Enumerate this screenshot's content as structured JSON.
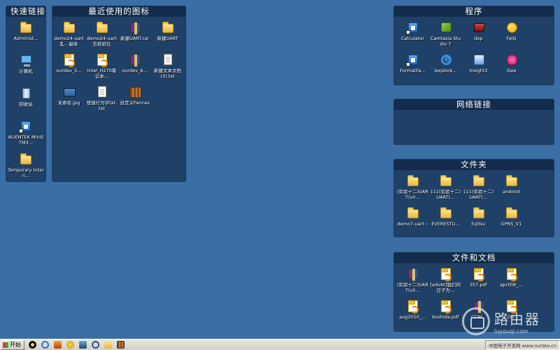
{
  "quick_links": {
    "title": "快速链接",
    "items": [
      {
        "label": "Administ...",
        "icon": "user-folder-icon"
      },
      {
        "label": "计算机",
        "icon": "computer-icon"
      },
      {
        "label": "回收站",
        "icon": "recycle-bin-icon"
      },
      {
        "label": "ALIENTEK MiniSTM3...",
        "icon": "app-shortcut-icon"
      },
      {
        "label": "Temporary Intern...",
        "icon": "folder-icon"
      }
    ]
  },
  "recent": {
    "title": "最近使用的图标",
    "items": [
      {
        "label": "demo24-uart乱 - 副本",
        "icon": "folder-icon"
      },
      {
        "label": "demo24-uart去校验位",
        "icon": "folder-icon"
      },
      {
        "label": "新建UART.rar",
        "icon": "rar-archive-icon"
      },
      {
        "label": "新建UART",
        "icon": "folder-icon"
      },
      {
        "label": "ourdev_5...",
        "icon": "pdf-icon"
      },
      {
        "label": "Intel_H270笔记本...",
        "icon": "pdf-icon"
      },
      {
        "label": "ourdev_6...",
        "icon": "rar-archive-icon"
      },
      {
        "label": "新建文本文档 (3).txt",
        "icon": "text-file-icon"
      },
      {
        "label": "未命名.jpg",
        "icon": "image-file-icon"
      },
      {
        "label": "怪诞行为学txt.txt",
        "icon": "text-file-icon"
      },
      {
        "label": "自定义Fences",
        "icon": "fences-icon"
      }
    ]
  },
  "programs": {
    "title": "程序",
    "items": [
      {
        "label": "Calculator",
        "icon": "calculator-icon"
      },
      {
        "label": "Camtasia Studio 7",
        "icon": "camtasia-icon"
      },
      {
        "label": "dxp",
        "icon": "dxp-icon"
      },
      {
        "label": "FeiQ",
        "icon": "feiq-icon"
      },
      {
        "label": "FormatFa...",
        "icon": "format-app-icon"
      },
      {
        "label": "iexplore...",
        "icon": "internet-explorer-icon"
      },
      {
        "label": "Insight3",
        "icon": "insight-icon"
      },
      {
        "label": "iSee",
        "icon": "isee-icon"
      }
    ]
  },
  "network": {
    "title": "网络链接",
    "items": []
  },
  "folders": {
    "title": "文件夹",
    "items": [
      {
        "label": "(实验十二)UART(v0...",
        "icon": "folder-icon"
      },
      {
        "label": "111(实验十二)UART(...",
        "icon": "folder-icon"
      },
      {
        "label": "111(实验十二)UART(...",
        "icon": "folder-icon"
      },
      {
        "label": "android",
        "icon": "folder-icon"
      },
      {
        "label": "demo7-uart~",
        "icon": "folder-icon"
      },
      {
        "label": "EVERESTU...",
        "icon": "folder-icon"
      },
      {
        "label": "fujitsu",
        "icon": "folder-icon"
      },
      {
        "label": "GPRS_V1",
        "icon": "folder-icon"
      }
    ]
  },
  "docs": {
    "title": "文件和文档",
    "items": [
      {
        "label": "(实验十二)UART(v0...",
        "icon": "rar-archive-icon"
      },
      {
        "label": "[edubt]我们的日子为...",
        "icon": "pdf-icon"
      },
      {
        "label": "357.pdf",
        "icon": "pdf-icon"
      },
      {
        "label": "april08_...",
        "icon": "pdf-icon"
      },
      {
        "label": "aug2010_...",
        "icon": "pdf-icon"
      },
      {
        "label": "boshida.pdf",
        "icon": "pdf-icon"
      },
      {
        "label": "CCW...",
        "icon": "rar-archive-icon"
      },
      {
        "label": "COB...",
        "icon": "pdf-icon"
      }
    ]
  },
  "taskbar": {
    "start_label": "开始",
    "tray_text": "中国电子开发网 www.ourdev.cn"
  },
  "watermark": {
    "cn": "路由器",
    "en": "luyouqi.com"
  }
}
